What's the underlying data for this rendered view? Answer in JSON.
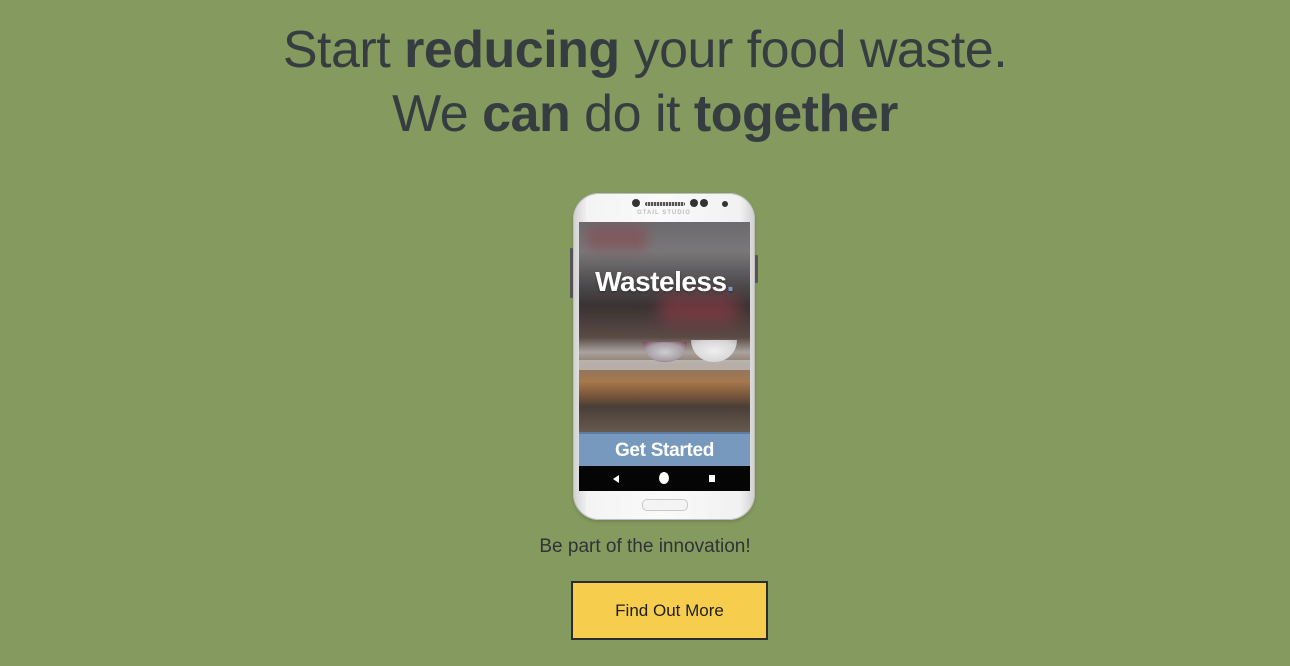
{
  "headline": {
    "line1": {
      "pre": "Start ",
      "bold": "reducing",
      "post": " your food waste."
    },
    "line2": {
      "pre": "We ",
      "bold1": "can",
      "mid": " do it ",
      "bold2": "together"
    }
  },
  "phone": {
    "brand": "GTAIL STUDIO",
    "app_title": "Wasteless",
    "app_title_dot": ".",
    "get_started_label": "Get Started",
    "nav_icons": [
      "back-icon",
      "home-icon",
      "recent-apps-icon"
    ]
  },
  "tagline": "Be part of the innovation!",
  "cta": {
    "label": "Find Out More"
  },
  "colors": {
    "background": "#859a5f",
    "text": "#363d40",
    "cta_background": "#f6cd4c",
    "get_started_background": "#7699bd"
  }
}
